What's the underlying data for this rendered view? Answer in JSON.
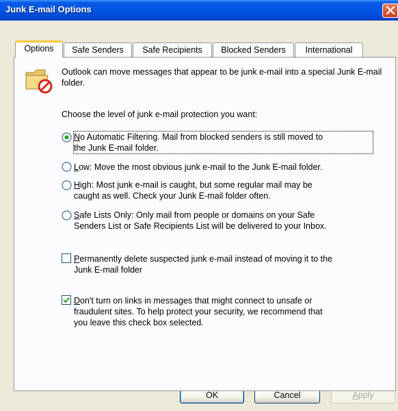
{
  "window": {
    "title": "Junk E-mail Options"
  },
  "tabs": [
    {
      "label": "Options",
      "active": true
    },
    {
      "label": "Safe Senders"
    },
    {
      "label": "Safe Recipients"
    },
    {
      "label": "Blocked Senders"
    },
    {
      "label": "International"
    }
  ],
  "intro": "Outlook can move messages that appear to be junk e-mail into a special Junk E-mail folder.",
  "prompt": "Choose the level of junk e-mail protection you want:",
  "levels": [
    {
      "key": "N",
      "rest_line1": "o Automatic Filtering.  Mail from blocked senders is still moved to",
      "line2": "the Junk E-mail folder.",
      "selected": true
    },
    {
      "key": "L",
      "rest_line1": "ow: Move the most obvious junk e-mail to the Junk E-mail folder.",
      "selected": false
    },
    {
      "key": "H",
      "rest_line1": "igh: Most junk e-mail is caught, but some regular mail may be",
      "line2": "caught as well. Check your Junk E-mail folder often.",
      "selected": false
    },
    {
      "key": "S",
      "rest_line1": "afe Lists Only: Only mail from people or domains on your Safe",
      "line2": "Senders List or Safe Recipients List will be delivered to your Inbox.",
      "selected": false
    }
  ],
  "options": [
    {
      "key": "P",
      "rest_line1": "ermanently delete suspected junk e-mail instead of moving it to the",
      "line2": "Junk E-mail folder",
      "checked": false
    },
    {
      "key": "D",
      "rest_line1": "on't turn on links in messages that might connect to unsafe or",
      "line2": "fraudulent sites.  To help protect your security, we recommend that",
      "line3": "you leave this check box selected.",
      "checked": true
    }
  ],
  "buttons": {
    "ok": "OK",
    "cancel": "Cancel",
    "apply_key": "A",
    "apply_rest": "pply"
  },
  "colors": {
    "title_bar": "#0054E3",
    "close": "#D8552F",
    "tab_highlight": "#FFC83C",
    "check": "#21A121"
  },
  "icons": {
    "folder": "junk-folder-icon",
    "close": "close-icon"
  }
}
